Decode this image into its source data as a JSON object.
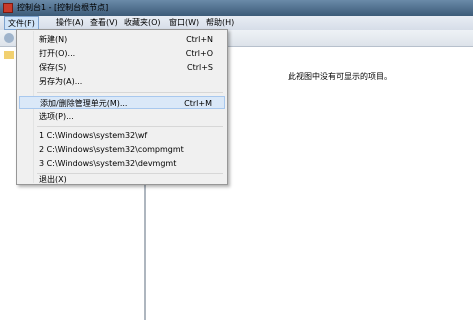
{
  "window": {
    "title": "控制台1 - [控制台根节点]"
  },
  "menubar": {
    "items": [
      "文件(F)",
      "操作(A)",
      "查看(V)",
      "收藏夹(O)",
      "窗口(W)",
      "帮助(H)"
    ]
  },
  "content": {
    "empty_message": "此视图中没有可显示的项目。"
  },
  "file_menu": {
    "new": {
      "label": "新建(N)",
      "shortcut": "Ctrl+N"
    },
    "open": {
      "label": "打开(O)...",
      "shortcut": "Ctrl+O"
    },
    "save": {
      "label": "保存(S)",
      "shortcut": "Ctrl+S"
    },
    "save_as": {
      "label": "另存为(A)..."
    },
    "add_remove_snapin": {
      "label": "添加/删除管理单元(M)...",
      "shortcut": "Ctrl+M"
    },
    "options": {
      "label": "选项(P)..."
    },
    "recent": [
      "1 C:\\Windows\\system32\\wf",
      "2 C:\\Windows\\system32\\compmgmt",
      "3 C:\\Windows\\system32\\devmgmt"
    ],
    "exit": {
      "label": "退出(X)"
    }
  }
}
